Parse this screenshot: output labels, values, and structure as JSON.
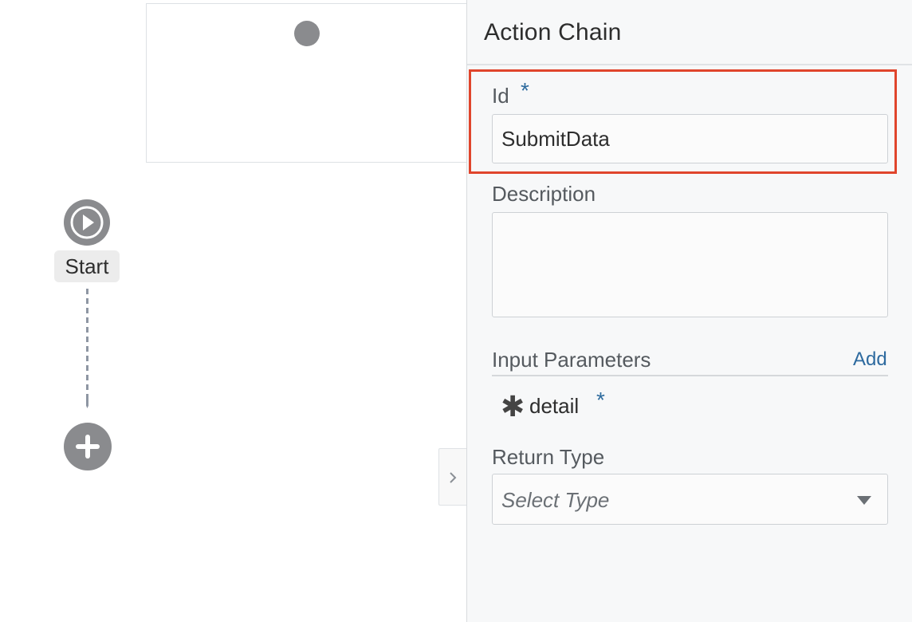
{
  "canvas": {
    "start_label": "Start"
  },
  "panel": {
    "title": "Action Chain",
    "id_label": "Id",
    "required_marker": "*",
    "id_value": "SubmitData",
    "description_label": "Description",
    "description_value": "",
    "input_parameters_label": "Input Parameters",
    "add_label": "Add",
    "parameters": [
      {
        "name": "detail",
        "required": "*"
      }
    ],
    "return_type_label": "Return Type",
    "return_type_placeholder": "Select Type"
  },
  "colors": {
    "highlight": "#e0452c",
    "link": "#2d6a9f",
    "node": "#8a8b8e"
  }
}
